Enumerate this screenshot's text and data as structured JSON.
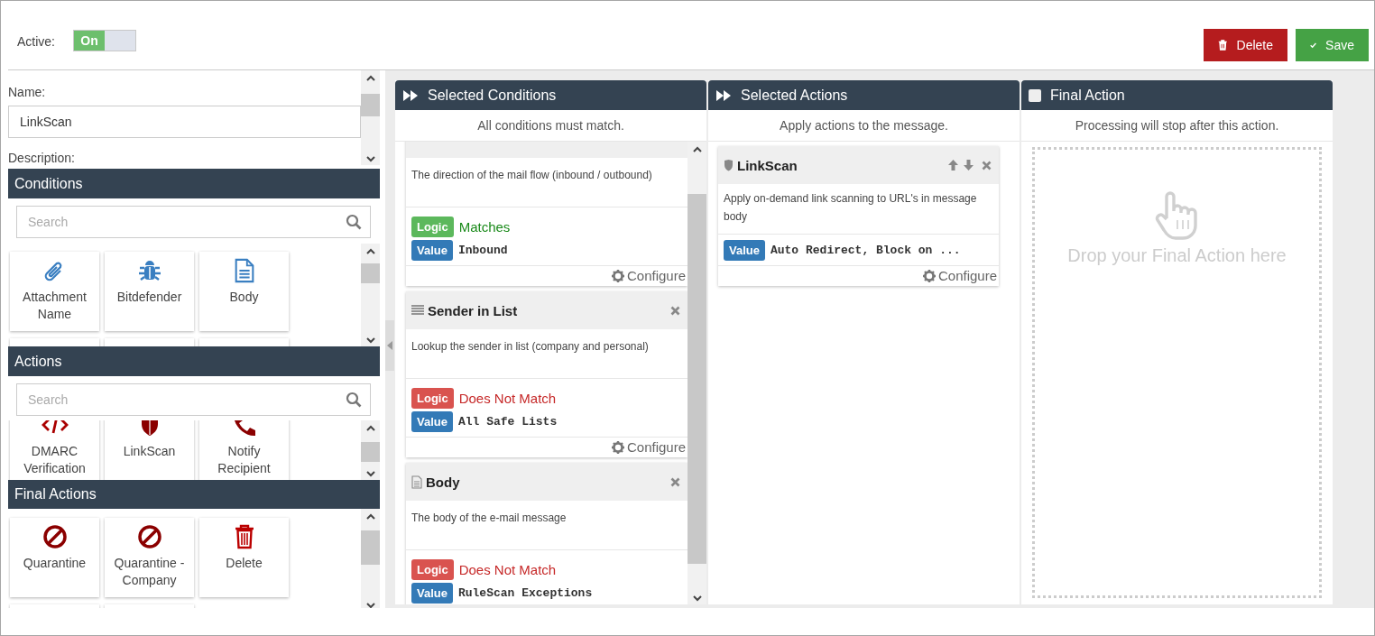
{
  "header": {
    "active_label": "Active:",
    "toggle": {
      "label": "On",
      "on": true
    },
    "buttons": [
      {
        "kind": "delete",
        "label": "Delete"
      },
      {
        "kind": "save",
        "label": "Save"
      }
    ]
  },
  "form": {
    "name_label": "Name:",
    "name_value": "LinkScan",
    "description_label": "Description:"
  },
  "library": [
    {
      "title": "Conditions",
      "search_placeholder": "Search",
      "tiles": [
        {
          "kind": "paperclip",
          "label": "Attachment Name"
        },
        {
          "kind": "bug",
          "label": "Bitdefender"
        },
        {
          "kind": "document",
          "label": "Body"
        },
        {
          "kind": "blank"
        },
        {
          "kind": "blank"
        },
        {
          "kind": "blank"
        }
      ]
    },
    {
      "title": "Actions",
      "search_placeholder": "Search",
      "tiles": [
        {
          "kind": "code",
          "label": "DMARC Verification"
        },
        {
          "kind": "shield",
          "label": "LinkScan"
        },
        {
          "kind": "phone",
          "label": "Notify Recipient"
        }
      ]
    },
    {
      "title": "Final Actions",
      "tiles": [
        {
          "kind": "no-entry",
          "label": "Quarantine"
        },
        {
          "kind": "no-entry",
          "label": "Quarantine - Company"
        },
        {
          "kind": "trash",
          "label": "Delete"
        },
        {
          "kind": "blank"
        },
        {
          "kind": "blank"
        }
      ]
    }
  ],
  "columns": [
    {
      "kind": "forward",
      "title": "Selected Conditions",
      "subtitle": "All conditions must match.",
      "cards": [
        {
          "description": "The direction of the mail flow (inbound / outbound)",
          "logic": {
            "label": "Logic",
            "value": "Matches",
            "match": true
          },
          "value": {
            "label": "Value",
            "text": "Inbound"
          },
          "configure": "Configure"
        },
        {
          "kind": "list",
          "title": "Sender in List",
          "description": "Lookup the sender in list (company and personal)",
          "logic": {
            "label": "Logic",
            "value": "Does Not Match",
            "match": false
          },
          "value": {
            "label": "Value",
            "text": "All Safe Lists"
          },
          "configure": "Configure"
        },
        {
          "kind": "document",
          "title": "Body",
          "description": "The body of the e-mail message",
          "logic": {
            "label": "Logic",
            "value": "Does Not Match",
            "match": false
          },
          "value": {
            "label": "Value",
            "text": "RuleScan Exceptions"
          }
        }
      ]
    },
    {
      "kind": "forward",
      "title": "Selected Actions",
      "subtitle": "Apply actions to the message.",
      "cards": [
        {
          "kind": "shield",
          "title": "LinkScan",
          "movable": true,
          "description": "Apply on-demand link scanning to URL's in message body",
          "value": {
            "label": "Value",
            "text": "Auto Redirect, Block on ..."
          },
          "configure": "Configure"
        }
      ]
    },
    {
      "kind": "checkbox",
      "checked": false,
      "title": "Final Action",
      "subtitle": "Processing will stop after this action.",
      "drop_hint": "Drop your Final Action here"
    }
  ]
}
